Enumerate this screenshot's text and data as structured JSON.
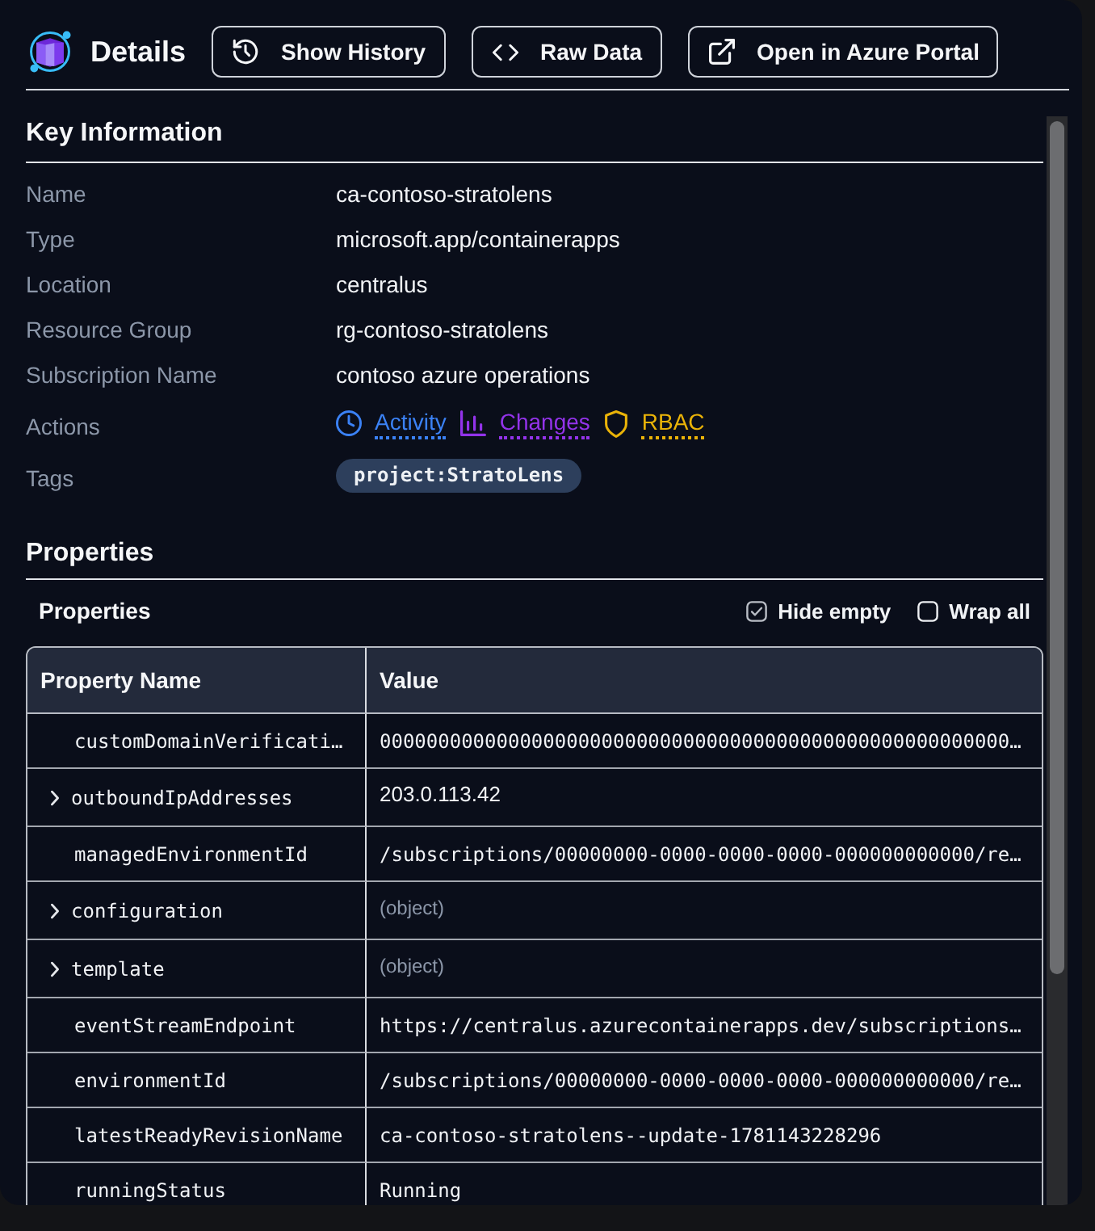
{
  "header": {
    "title": "Details",
    "buttons": [
      {
        "label": "Show History",
        "kind": "history"
      },
      {
        "label": "Raw Data",
        "kind": "raw"
      },
      {
        "label": "Open in Azure Portal",
        "kind": "portal"
      }
    ]
  },
  "key_information": {
    "heading": "Key Information",
    "fields": [
      {
        "label": "Name",
        "kind": "text",
        "value": "ca-contoso-stratolens"
      },
      {
        "label": "Type",
        "kind": "text",
        "value": "microsoft.app/containerapps"
      },
      {
        "label": "Location",
        "kind": "text",
        "value": "centralus"
      },
      {
        "label": "Resource Group",
        "kind": "text",
        "value": "rg-contoso-stratolens"
      },
      {
        "label": "Subscription Name",
        "kind": "text",
        "value": "contoso azure operations"
      },
      {
        "label": "Actions",
        "kind": "actions",
        "links": [
          {
            "label": "Activity",
            "kind": "activity",
            "color": "#3b82f6"
          },
          {
            "label": "Changes",
            "kind": "changes",
            "color": "#9333ea"
          },
          {
            "label": "RBAC",
            "kind": "rbac",
            "color": "#eab308"
          }
        ]
      },
      {
        "label": "Tags",
        "kind": "tags",
        "tags": [
          "project:StratoLens"
        ]
      }
    ]
  },
  "properties": {
    "heading": "Properties",
    "table_title": "Properties",
    "options": [
      {
        "label": "Hide empty",
        "checked": true
      },
      {
        "label": "Wrap all",
        "checked": false
      }
    ],
    "table": {
      "columns": [
        "Property Name",
        "Value"
      ],
      "rows": [
        {
          "name": "customDomainVerificati…",
          "kind": "string",
          "value": "000000000000000000000000000000000000000000000000000000…"
        },
        {
          "name": "outboundIpAddresses",
          "kind": "array",
          "value": "203.0.113.42"
        },
        {
          "name": "managedEnvironmentId",
          "kind": "string",
          "value": "/subscriptions/00000000-0000-0000-0000-000000000000/re…"
        },
        {
          "name": "configuration",
          "kind": "object",
          "value": "(object)"
        },
        {
          "name": "template",
          "kind": "object",
          "value": "(object)"
        },
        {
          "name": "eventStreamEndpoint",
          "kind": "string",
          "value": "https://centralus.azurecontainerapps.dev/subscriptions…"
        },
        {
          "name": "environmentId",
          "kind": "string",
          "value": "/subscriptions/00000000-0000-0000-0000-000000000000/re…"
        },
        {
          "name": "latestReadyRevisionName",
          "kind": "string",
          "value": "ca-contoso-stratolens--update-1781143228296"
        },
        {
          "name": "runningStatus",
          "kind": "string",
          "value": "Running"
        }
      ]
    }
  }
}
